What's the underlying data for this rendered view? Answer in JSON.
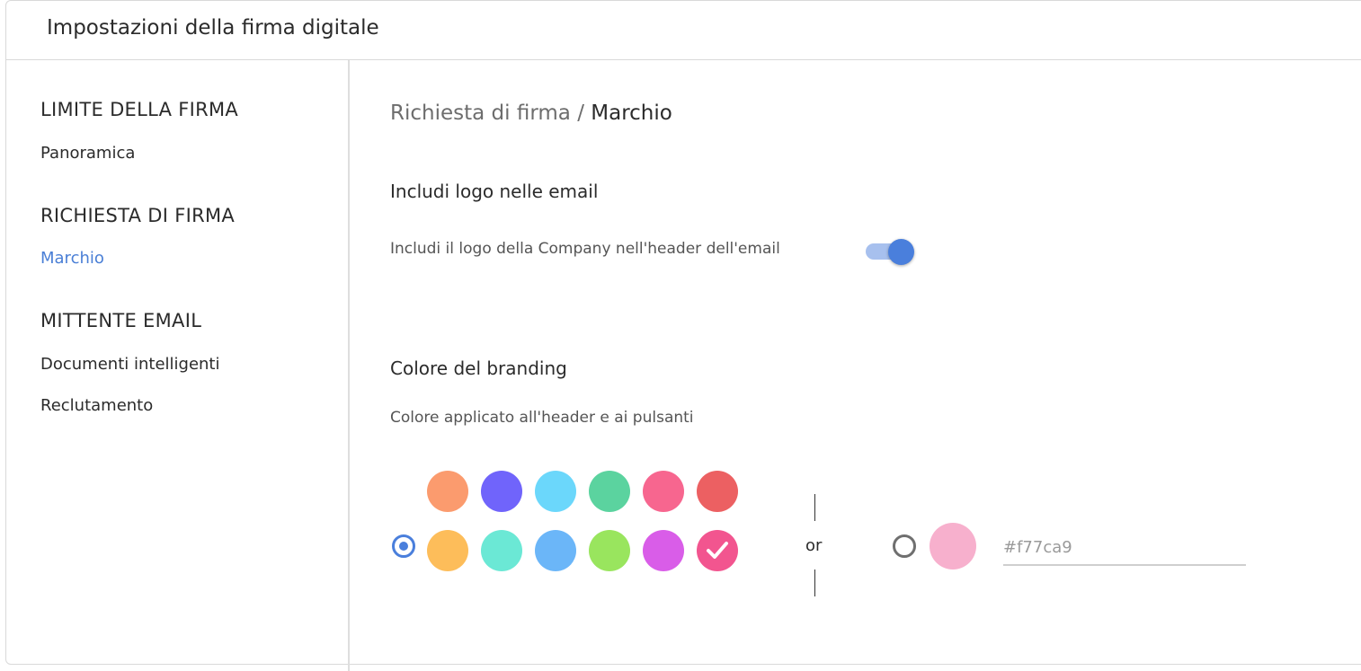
{
  "header": {
    "title": "Impostazioni della firma digitale"
  },
  "sidebar": {
    "sections": [
      {
        "heading": "LIMITE DELLA FIRMA",
        "items": [
          "Panoramica"
        ]
      },
      {
        "heading": "RICHIESTA DI FIRMA",
        "items": [
          "Marchio"
        ]
      },
      {
        "heading": "MITTENTE EMAIL",
        "items": [
          "Documenti intelligenti",
          "Reclutamento"
        ]
      }
    ],
    "active_item": "Marchio"
  },
  "breadcrumb": {
    "parent": "Richiesta di firma",
    "separator": " / ",
    "current": "Marchio"
  },
  "logo_section": {
    "title": "Includi logo nelle email",
    "toggle_label": "Includi il logo della Company nell'header dell'email",
    "toggle_on": true
  },
  "branding_section": {
    "title": "Colore del branding",
    "description": "Colore applicato all'header e ai pulsanti",
    "preset_selected": true,
    "palette_row1": [
      "#fb9b6e",
      "#7064fb",
      "#6bd7fb",
      "#5bd39f",
      "#f7668f",
      "#ec6062"
    ],
    "palette_row2": [
      "#fdbd5a",
      "#6be8d5",
      "#6bb6f8",
      "#99e55e",
      "#d95de8",
      "#f2558f"
    ],
    "selected_color": "#f2558f",
    "or_label": "or",
    "custom": {
      "preview_color": "#f7b0cd",
      "placeholder": "#f77ca9",
      "value": ""
    }
  },
  "colors": {
    "accent": "#4a7fdc",
    "link_active": "#4a7fd6"
  }
}
